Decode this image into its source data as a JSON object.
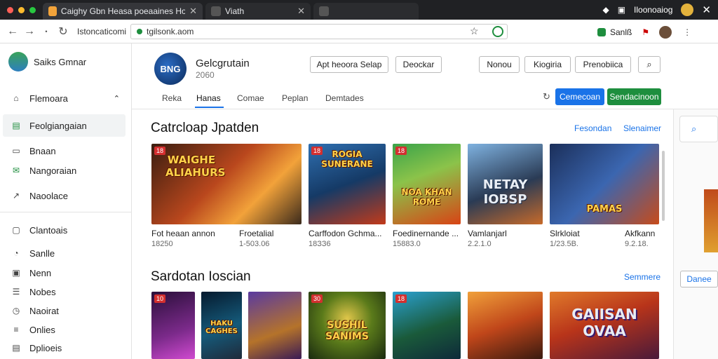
{
  "browser": {
    "tabs": [
      {
        "label": "Caighy Gbn Heasa poeaaines Hoddk..."
      },
      {
        "label": "Viath"
      }
    ],
    "right_label": "Iloonoaiog",
    "url": "tgilsonk.aom",
    "address_hint": "Istoncaticomi",
    "profile_label": "Sanlß"
  },
  "sidebar": {
    "user_name": "Saiks Gmnar",
    "items": [
      {
        "label": "Flemoara",
        "icon": "home-icon"
      },
      {
        "label": "Feolgiangaian",
        "icon": "grid-icon"
      },
      {
        "label": "Bnaan",
        "icon": "library-icon"
      },
      {
        "label": "Nangoraian",
        "icon": "mail-icon"
      },
      {
        "label": "Naoolace",
        "icon": "trend-icon"
      },
      {
        "label": "Clantoais",
        "icon": "chat-icon"
      },
      {
        "label": "Sanlle",
        "icon": "pin-icon"
      },
      {
        "label": "Nenn",
        "icon": "image-icon"
      },
      {
        "label": "Nobes",
        "icon": "note-icon"
      },
      {
        "label": "Naoirat",
        "icon": "clock-icon"
      },
      {
        "label": "Onlies",
        "icon": "list-icon"
      },
      {
        "label": "Dplioeis",
        "icon": "doc-icon"
      }
    ]
  },
  "header": {
    "logo_text": "BNG",
    "app_name": "Gelcgrutain",
    "app_sub": "2060",
    "buttons": {
      "primary": "Apt heoora Selap",
      "secondary": "Deockar"
    },
    "right_buttons": [
      "Nonou",
      "Kiogiria",
      "Prenobiica"
    ],
    "nav_tabs": [
      "Reka",
      "Hanas",
      "Comae",
      "Peplan",
      "Demtades"
    ],
    "action_blue": "Cemecoan",
    "action_green": "Sendacinoon"
  },
  "sections": [
    {
      "title": "Catrcloap Jpatden",
      "links": [
        "Fesondan",
        "Slenaimer"
      ],
      "games": [
        {
          "title": "Fot heaan annon",
          "meta": "18250",
          "art": "WAIGHE ALIAHURS",
          "badge": "18"
        },
        {
          "title": "Froetalial",
          "meta": "1-503.06",
          "art": "",
          "badge": ""
        },
        {
          "title": "Carffodon Gchma...",
          "meta": "18ЗЗ6",
          "art": "ROGIA SUNERANE",
          "badge": "18"
        },
        {
          "title": "Foedinernande ...",
          "meta": "15883.0",
          "art": "NOA KHAN ROME",
          "badge": "18"
        },
        {
          "title": "Vamlanjarl",
          "meta": "2.2.1.0",
          "art": "NETAY IOBSP",
          "badge": ""
        },
        {
          "title": "Slrkloiat",
          "meta": "1/23.5B.",
          "art": "PAMAS",
          "badge": ""
        },
        {
          "title": "Akfkann",
          "meta": "9.2.18.",
          "art": "",
          "badge": ""
        }
      ]
    },
    {
      "title": "Sardotan Ioscian",
      "links": [
        "Semmere"
      ],
      "games": [
        {
          "art": "",
          "badge": "10"
        },
        {
          "art": "HAKU CAGHES",
          "badge": ""
        },
        {
          "art": "",
          "badge": ""
        },
        {
          "art": "SUSHIL SANIMS",
          "badge": "30"
        },
        {
          "art": "",
          "badge": "18"
        },
        {
          "art": "",
          "badge": ""
        },
        {
          "art": "GAIISAN OVAA",
          "badge": ""
        }
      ]
    }
  ],
  "right_panel": {
    "button": "Danee"
  },
  "colors": {
    "accent_blue": "#1a73e8",
    "accent_green": "#1e8e3e",
    "tab_dark": "#202124"
  }
}
